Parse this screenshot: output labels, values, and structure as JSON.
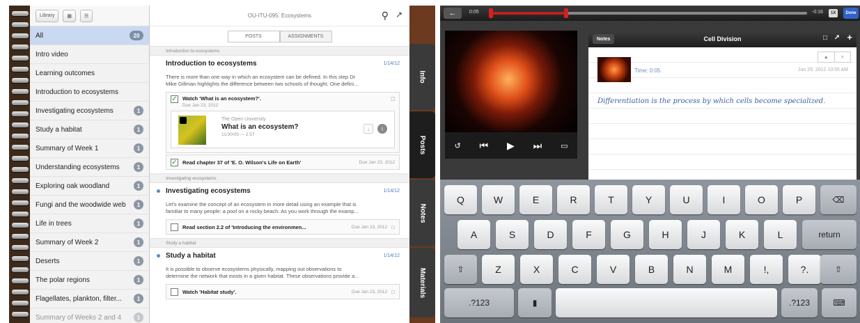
{
  "left": {
    "toolbar": {
      "library_label": "Library"
    },
    "header_title": "OU-ITU-095: Ecosystems",
    "segments": [
      "POSTS",
      "ASSIGNMENTS"
    ],
    "sidebar": [
      {
        "label": "All",
        "badge": "20"
      },
      {
        "label": "Intro video",
        "badge": ""
      },
      {
        "label": "Learning outcomes",
        "badge": ""
      },
      {
        "label": "Introduction to ecosystems",
        "badge": ""
      },
      {
        "label": "Investigating ecosystems",
        "badge": "1"
      },
      {
        "label": "Study a habitat",
        "badge": "1"
      },
      {
        "label": "Summary of Week 1",
        "badge": "1"
      },
      {
        "label": "Understanding ecosystems",
        "badge": "1"
      },
      {
        "label": "Exploring oak woodland",
        "badge": "1"
      },
      {
        "label": "Fungi and the woodwide web",
        "badge": "1"
      },
      {
        "label": "Life in trees",
        "badge": "1"
      },
      {
        "label": "Summary of Week 2",
        "badge": "1"
      },
      {
        "label": "Deserts",
        "badge": "1"
      },
      {
        "label": "The polar regions",
        "badge": "1"
      },
      {
        "label": "Flagellates, plankton, filter...",
        "badge": "1"
      },
      {
        "label": "Summary of Weeks 2 and 4",
        "badge": "1"
      }
    ],
    "sections": {
      "s1": {
        "header": "Introduction to ecosystems",
        "title": "Introduction to ecosystems",
        "date": "1/14/12",
        "text1": "There is more than one way in which an ecosystem can be defined. In this step Dr",
        "text2": "Mike Gillman highlights the difference between two schools of thought. One defini...",
        "task1": "Watch 'What is an ecosystem?'.",
        "task1_due": "Due Jan 23, 2012",
        "resource_source": "The Open University",
        "resource_title": "What is an ecosystem?",
        "resource_meta": "11/30/09 — 2:57",
        "task2": "Read chapter 37 of 'E. O. Wilson's Life on Earth'",
        "task2_due": "Due Jan 23, 2012"
      },
      "s2": {
        "header": "Investigating ecosystems",
        "title": "Investigating ecosystems",
        "date": "1/14/12",
        "text1": "Let's examine the concept of an ecosystem in more detail using an example that is",
        "text2": "familiar to many people: a pool on a rocky beach. As you work through the examp...",
        "task1": "Read section 2.2 of 'Introducing the environmen...",
        "task1_due": "Due Jan 23, 2012"
      },
      "s3": {
        "header": "Study a habitat",
        "title": "Study a habitat",
        "date": "1/14/12",
        "text1": "It is possible to observe ecosystems physically, mapping out observations to",
        "text2": "determine the network that exists in a given habitat. These observations provide a...",
        "task1": "Watch 'Habitat study'.",
        "task1_due": "Due Jan 23, 2012"
      }
    },
    "tabs": [
      "Info",
      "Posts",
      "Notes",
      "Materials"
    ]
  },
  "right": {
    "time_elapsed": "0:05",
    "time_remaining": "-0:16",
    "speed_label": "1X",
    "done_label": "Done",
    "progress": 0.24,
    "notes_button": "Notes",
    "note_title": "Cell Division",
    "note_time": "Time: 0:05",
    "note_date": "Jun 29, 2012 10:55 AM",
    "note_text": "Differentiation is the process by which cells become specialized.",
    "keyboard": {
      "row1": [
        "Q",
        "W",
        "E",
        "R",
        "T",
        "Y",
        "U",
        "I",
        "O",
        "P"
      ],
      "row2": [
        "A",
        "S",
        "D",
        "F",
        "G",
        "H",
        "J",
        "K",
        "L"
      ],
      "row3": [
        "Z",
        "X",
        "C",
        "V",
        "B",
        "N",
        "M",
        "!,",
        "?."
      ],
      "return_label": "return",
      "numbers_label": ".?123"
    }
  }
}
